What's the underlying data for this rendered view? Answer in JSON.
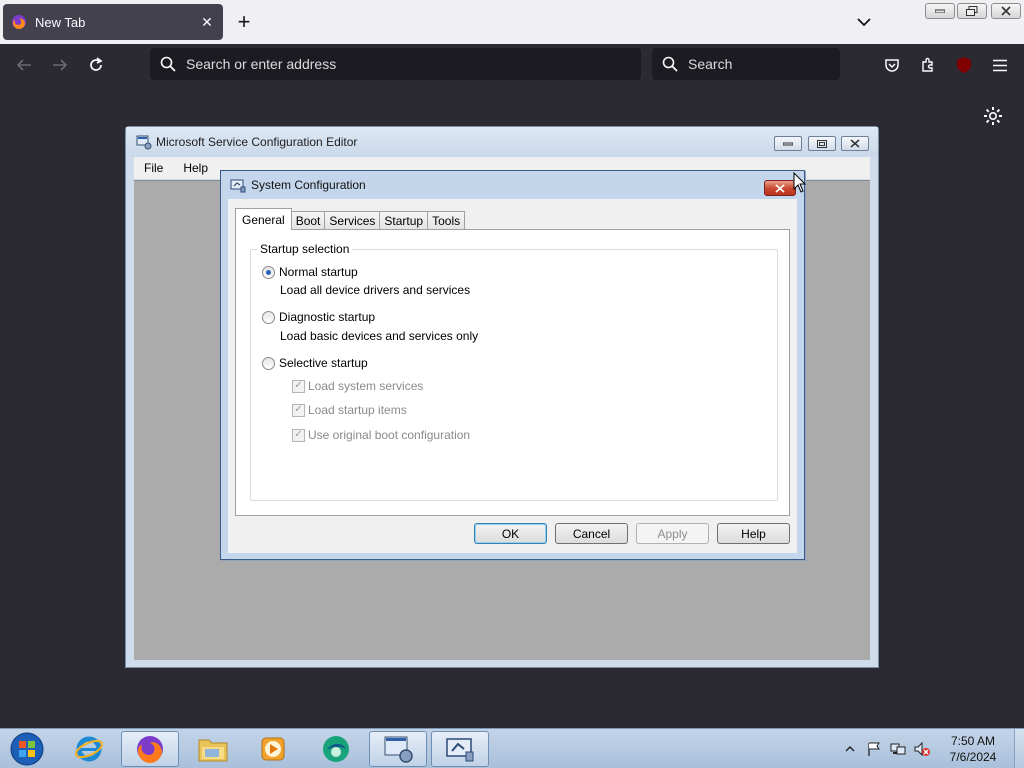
{
  "browser": {
    "tab_title": "New Tab",
    "address_placeholder": "Search or enter address",
    "search_placeholder": "Search",
    "extension_badge": "uO"
  },
  "editor": {
    "title": "Microsoft Service Configuration Editor",
    "menu": [
      "File",
      "Help"
    ]
  },
  "dialog": {
    "title": "System Configuration",
    "tabs": [
      "General",
      "Boot",
      "Services",
      "Startup",
      "Tools"
    ],
    "active_tab": "General",
    "group_label": "Startup selection",
    "options": [
      {
        "label": "Normal startup",
        "description": "Load all device drivers and services",
        "selected": true
      },
      {
        "label": "Diagnostic startup",
        "description": "Load basic devices and services only",
        "selected": false
      },
      {
        "label": "Selective startup",
        "description": "",
        "selected": false
      }
    ],
    "selective_items": [
      {
        "label": "Load system services",
        "checked": true,
        "enabled": false
      },
      {
        "label": "Load startup items",
        "checked": true,
        "enabled": false
      },
      {
        "label": "Use original boot configuration",
        "checked": true,
        "enabled": false
      }
    ],
    "buttons": {
      "ok": "OK",
      "cancel": "Cancel",
      "apply": "Apply",
      "help": "Help"
    }
  },
  "taskbar": {
    "time": "7:50 AM",
    "date": "7/6/2024"
  },
  "colors": {
    "browser_bg": "#2b2a33",
    "toolbar_field": "#1c1b22",
    "dialog_frame": "#c4d6ec",
    "taskbar": "#b6cbe2",
    "close_red": "#c8462c"
  }
}
